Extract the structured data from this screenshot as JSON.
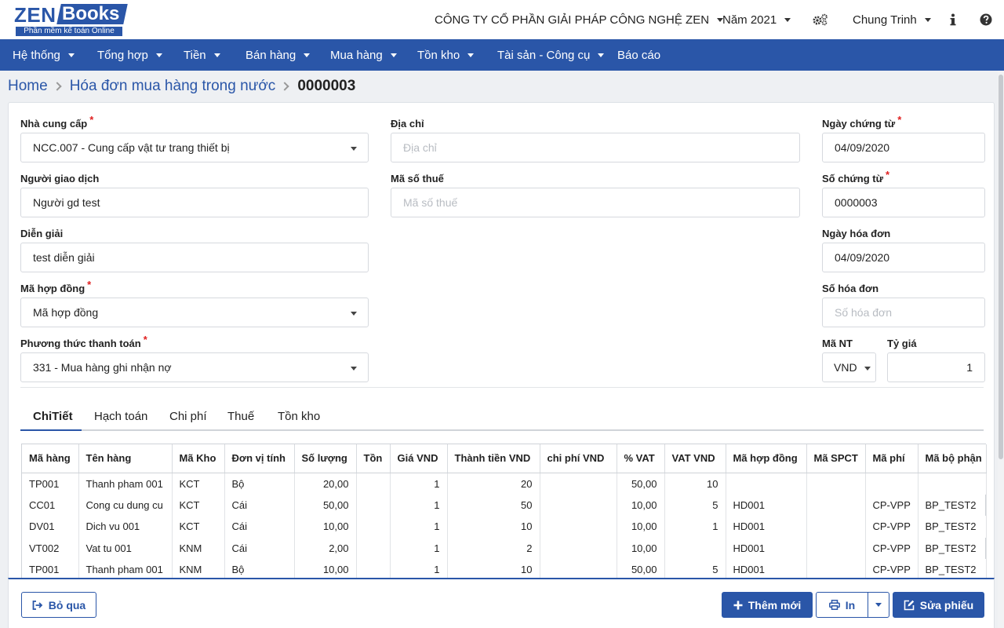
{
  "brand": {
    "logo_left": "ZEN",
    "logo_right": "Books",
    "tagline": "Phần mềm kế toán Online"
  },
  "header": {
    "company": "CÔNG TY CỔ PHẦN GIẢI PHÁP CÔNG NGHỆ ZEN",
    "year": "Năm 2021",
    "user": "Chung Trinh",
    "icons": [
      "gears-icon",
      "info-icon",
      "help-icon"
    ]
  },
  "menu": [
    {
      "label": "Hệ thống",
      "has_caret": true
    },
    {
      "label": "Tổng hợp",
      "has_caret": true
    },
    {
      "label": "Tiền",
      "has_caret": true
    },
    {
      "label": "Bán hàng",
      "has_caret": true
    },
    {
      "label": "Mua hàng",
      "has_caret": true
    },
    {
      "label": "Tồn kho",
      "has_caret": true
    },
    {
      "label": "Tài sản - Công cụ",
      "has_caret": true
    },
    {
      "label": "Báo cáo",
      "has_caret": false
    }
  ],
  "breadcrumb": {
    "home": "Home",
    "section": "Hóa đơn mua hàng trong nước",
    "current": "0000003"
  },
  "form": {
    "supplier": {
      "label": "Nhà cung cấp",
      "required": "*",
      "value": "NCC.007 - Cung cấp vật tư trang thiết bị"
    },
    "contact": {
      "label": "Người giao dịch",
      "value": "Người gd test"
    },
    "description": {
      "label": "Diễn giải",
      "value": "test diễn giải"
    },
    "contract": {
      "label": "Mã hợp đồng",
      "required": "*",
      "value": "Mã hợp đồng"
    },
    "payment": {
      "label": "Phương thức thanh toán",
      "required": "*",
      "value": "331 - Mua hàng ghi nhận nợ"
    },
    "address": {
      "label": "Địa chỉ",
      "placeholder": "Địa chỉ"
    },
    "tax_code": {
      "label": "Mã số thuế",
      "placeholder": "Mã số thuế"
    },
    "doc_date": {
      "label": "Ngày chứng từ",
      "required": "*",
      "value": "04/09/2020"
    },
    "doc_no": {
      "label": "Số chứng từ",
      "required": "*",
      "value": "0000003"
    },
    "invoice_date": {
      "label": "Ngày hóa đơn",
      "value": "04/09/2020"
    },
    "invoice_no": {
      "label": "Số hóa đơn",
      "placeholder": "Số hóa đơn"
    },
    "currency": {
      "label": "Mã NT",
      "value": "VND"
    },
    "rate": {
      "label": "Tỷ giá",
      "value": "1"
    }
  },
  "tabs": [
    "ChiTiết",
    "Hạch toán",
    "Chi phí",
    "Thuế",
    "Tồn kho"
  ],
  "active_tab": "ChiTiết",
  "table": {
    "columns": [
      "Mã hàng",
      "Tên hàng",
      "Mã Kho",
      "Đơn vị tính",
      "Số lượng",
      "Tồn",
      "Giá VND",
      "Thành tiền VND",
      "chi phí VND",
      "% VAT",
      "VAT VND",
      "Mã hợp đồng",
      "Mã SPCT",
      "Mã phí",
      "Mã bộ phận"
    ],
    "rows": [
      [
        "TP001",
        "Thanh pham 001",
        "KCT",
        "Bộ",
        "20,00",
        "",
        "1",
        "20",
        "",
        "50,00",
        "10",
        "",
        "",
        "",
        ""
      ],
      [
        "CC01",
        "Cong cu dung cu",
        "KCT",
        "Cái",
        "50,00",
        "",
        "1",
        "50",
        "",
        "10,00",
        "5",
        "HD001",
        "",
        "CP-VPP",
        "BP_TEST2"
      ],
      [
        "DV01",
        "Dich vu 001",
        "KCT",
        "Cái",
        "10,00",
        "",
        "1",
        "10",
        "",
        "10,00",
        "1",
        "HD001",
        "",
        "CP-VPP",
        "BP_TEST2"
      ],
      [
        "VT002",
        "Vat tu 001",
        "KNM",
        "Cái",
        "2,00",
        "",
        "1",
        "2",
        "",
        "10,00",
        "",
        "HD001",
        "",
        "CP-VPP",
        "BP_TEST2"
      ],
      [
        "TP001",
        "Thanh pham 001",
        "KNM",
        "Bộ",
        "10,00",
        "",
        "1",
        "10",
        "",
        "50,00",
        "5",
        "HD001",
        "",
        "CP-VPP",
        "BP_TEST2"
      ]
    ]
  },
  "footer": {
    "skip": "Bỏ qua",
    "add_new": "Thêm mới",
    "print": "In",
    "edit": "Sửa phiếu"
  },
  "colors": {
    "primary": "#2a56a8",
    "required": "#e02020",
    "background": "#eef0f3"
  }
}
